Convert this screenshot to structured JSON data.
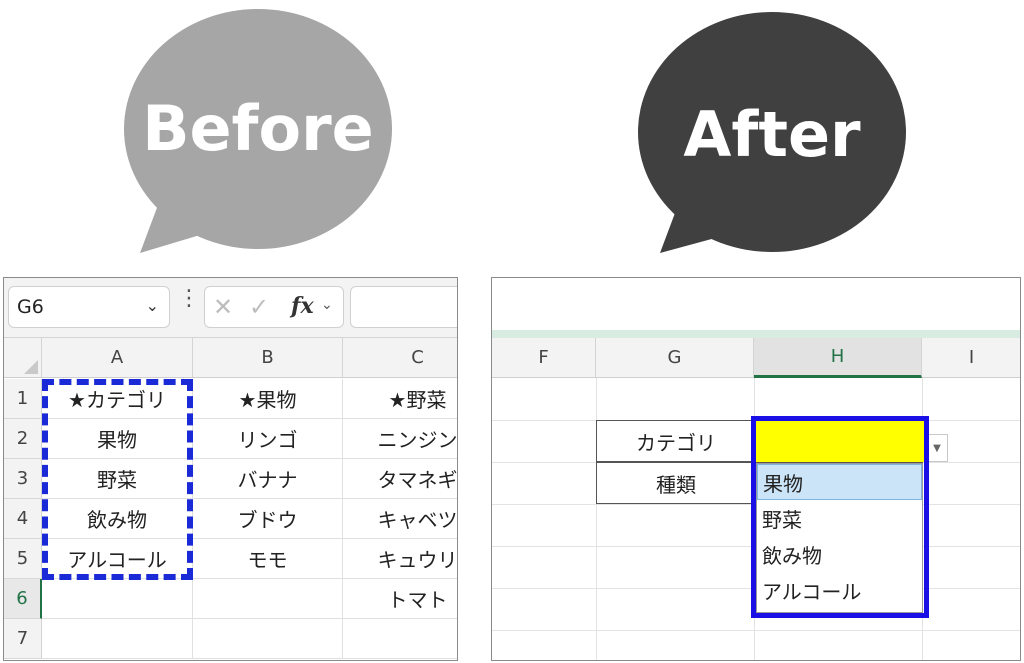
{
  "labels": {
    "before": "Before",
    "after": "After"
  },
  "colors": {
    "before_bubble": "#a6a6a6",
    "after_bubble": "#404040",
    "dash_box": "#1a2ad6",
    "highlight": "#ffff00",
    "blue_box": "#1a10e6"
  },
  "before": {
    "name_box": "G6",
    "fx_label": "fx",
    "columns": [
      "A",
      "B",
      "C"
    ],
    "rows": [
      "1",
      "2",
      "3",
      "4",
      "5",
      "6",
      "7"
    ],
    "cells": [
      [
        "★カテゴリ",
        "★果物",
        "★野菜"
      ],
      [
        "果物",
        "リンゴ",
        "ニンジン"
      ],
      [
        "野菜",
        "バナナ",
        "タマネギ"
      ],
      [
        "飲み物",
        "ブドウ",
        "キャベツ"
      ],
      [
        "アルコール",
        "モモ",
        "キュウリ"
      ],
      [
        "",
        "",
        "トマト"
      ],
      [
        "",
        "",
        ""
      ]
    ]
  },
  "after": {
    "columns": [
      "F",
      "G",
      "H",
      "I"
    ],
    "table": {
      "row1_label": "カテゴリ",
      "row2_label": "種類"
    },
    "dropdown_options": [
      "果物",
      "野菜",
      "飲み物",
      "アルコール"
    ],
    "dropdown_arrow": "▼"
  }
}
